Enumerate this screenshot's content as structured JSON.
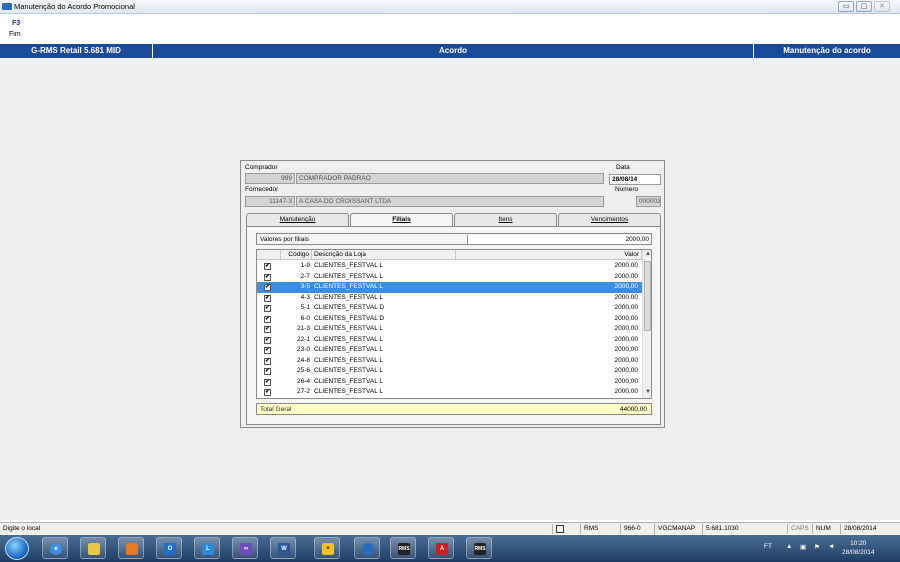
{
  "window": {
    "title": "Manutenção do Acordo Promocional",
    "minimize": "▭",
    "maximize": "▢",
    "close": "✕"
  },
  "toolbar": {
    "key": "F3",
    "label": "Fim"
  },
  "header": {
    "left": "G-RMS Retail 5.681 MID",
    "center": "Acordo",
    "right": "Manutenção do acordo"
  },
  "form": {
    "comprador_label": "Comprador",
    "comprador_code": "999",
    "comprador_name": "COMPRADOR PADRAO",
    "data_label": "Data",
    "data_value": "28/08/14",
    "fornecedor_label": "Fornecedor",
    "fornecedor_code": "11147-3",
    "fornecedor_name": "A CASA DO CROISSANT LTDA",
    "numero_label": "Numero",
    "numero_value": "00000330"
  },
  "tabs": [
    {
      "label": "Manutenção"
    },
    {
      "label": "Filiais"
    },
    {
      "label": "Itens"
    },
    {
      "label": "Vencimentos"
    }
  ],
  "valores": {
    "label": "Valores por filiais",
    "value": "2000,00"
  },
  "grid": {
    "headers": {
      "codigo": "Código",
      "descricao": "Descrição da Loja",
      "valor": "Valor"
    },
    "rows": [
      {
        "checked": "✔",
        "codigo": "1-9",
        "descricao": "CLIENTES_FESTVAL L",
        "valor": "2000,00"
      },
      {
        "checked": "✔",
        "codigo": "2-7",
        "descricao": "CLIENTES_FESTVAL L",
        "valor": "2000,00"
      },
      {
        "checked": "✔",
        "codigo": "3-5",
        "descricao": "CLIENTES_FESTVAL L",
        "valor": "2000,00"
      },
      {
        "checked": "✔",
        "codigo": "4-3",
        "descricao": "CLIENTES_FESTVAL L",
        "valor": "2000,00"
      },
      {
        "checked": "✔",
        "codigo": "5-1",
        "descricao": "CLIENTES_FESTVAL D",
        "valor": "2000,00"
      },
      {
        "checked": "✔",
        "codigo": "6-0",
        "descricao": "CLIENTES_FESTVAL D",
        "valor": "2000,00"
      },
      {
        "checked": "✔",
        "codigo": "21-3",
        "descricao": "CLIENTES_FESTVAL L",
        "valor": "2000,00"
      },
      {
        "checked": "✔",
        "codigo": "22-1",
        "descricao": "CLIENTES_FESTVAL L",
        "valor": "2000,00"
      },
      {
        "checked": "✔",
        "codigo": "23-0",
        "descricao": "CLIENTES_FESTVAL L",
        "valor": "2000,00"
      },
      {
        "checked": "✔",
        "codigo": "24-8",
        "descricao": "CLIENTES_FESTVAL L",
        "valor": "2000,00"
      },
      {
        "checked": "✔",
        "codigo": "25-6",
        "descricao": "CLIENTES_FESTVAL L",
        "valor": "2000,00"
      },
      {
        "checked": "✔",
        "codigo": "26-4",
        "descricao": "CLIENTES_FESTVAL L",
        "valor": "2000,00"
      },
      {
        "checked": "✔",
        "codigo": "27-2",
        "descricao": "CLIENTES_FESTVAL L",
        "valor": "2000,00"
      }
    ],
    "selected_index": 2,
    "scroll_up": "▲",
    "scroll_down": "▼"
  },
  "total": {
    "label": "Total Geral",
    "value": "44000,00"
  },
  "statusbar": {
    "left": "Digite o local",
    "rms": "RMS",
    "code": "966-0",
    "program": "VGCMANAP",
    "version": "5.681.1030",
    "caps": "CAPS",
    "num": "NUM",
    "date": "28/08/2014"
  },
  "taskbar": {
    "apps": [
      "ie",
      "explorer",
      "media",
      "outlook",
      "lync",
      "infopath",
      "word",
      "launcher",
      "citrix",
      "rms",
      "acrobat",
      "rms"
    ],
    "rms_label": "RMS",
    "tray_ft": "FT",
    "time": "10:20",
    "date": "28/08/2014"
  },
  "colors": {
    "header_blue": "#1a4a98",
    "selection": "#3a8ee6",
    "total_bg": "#ffffc8"
  }
}
